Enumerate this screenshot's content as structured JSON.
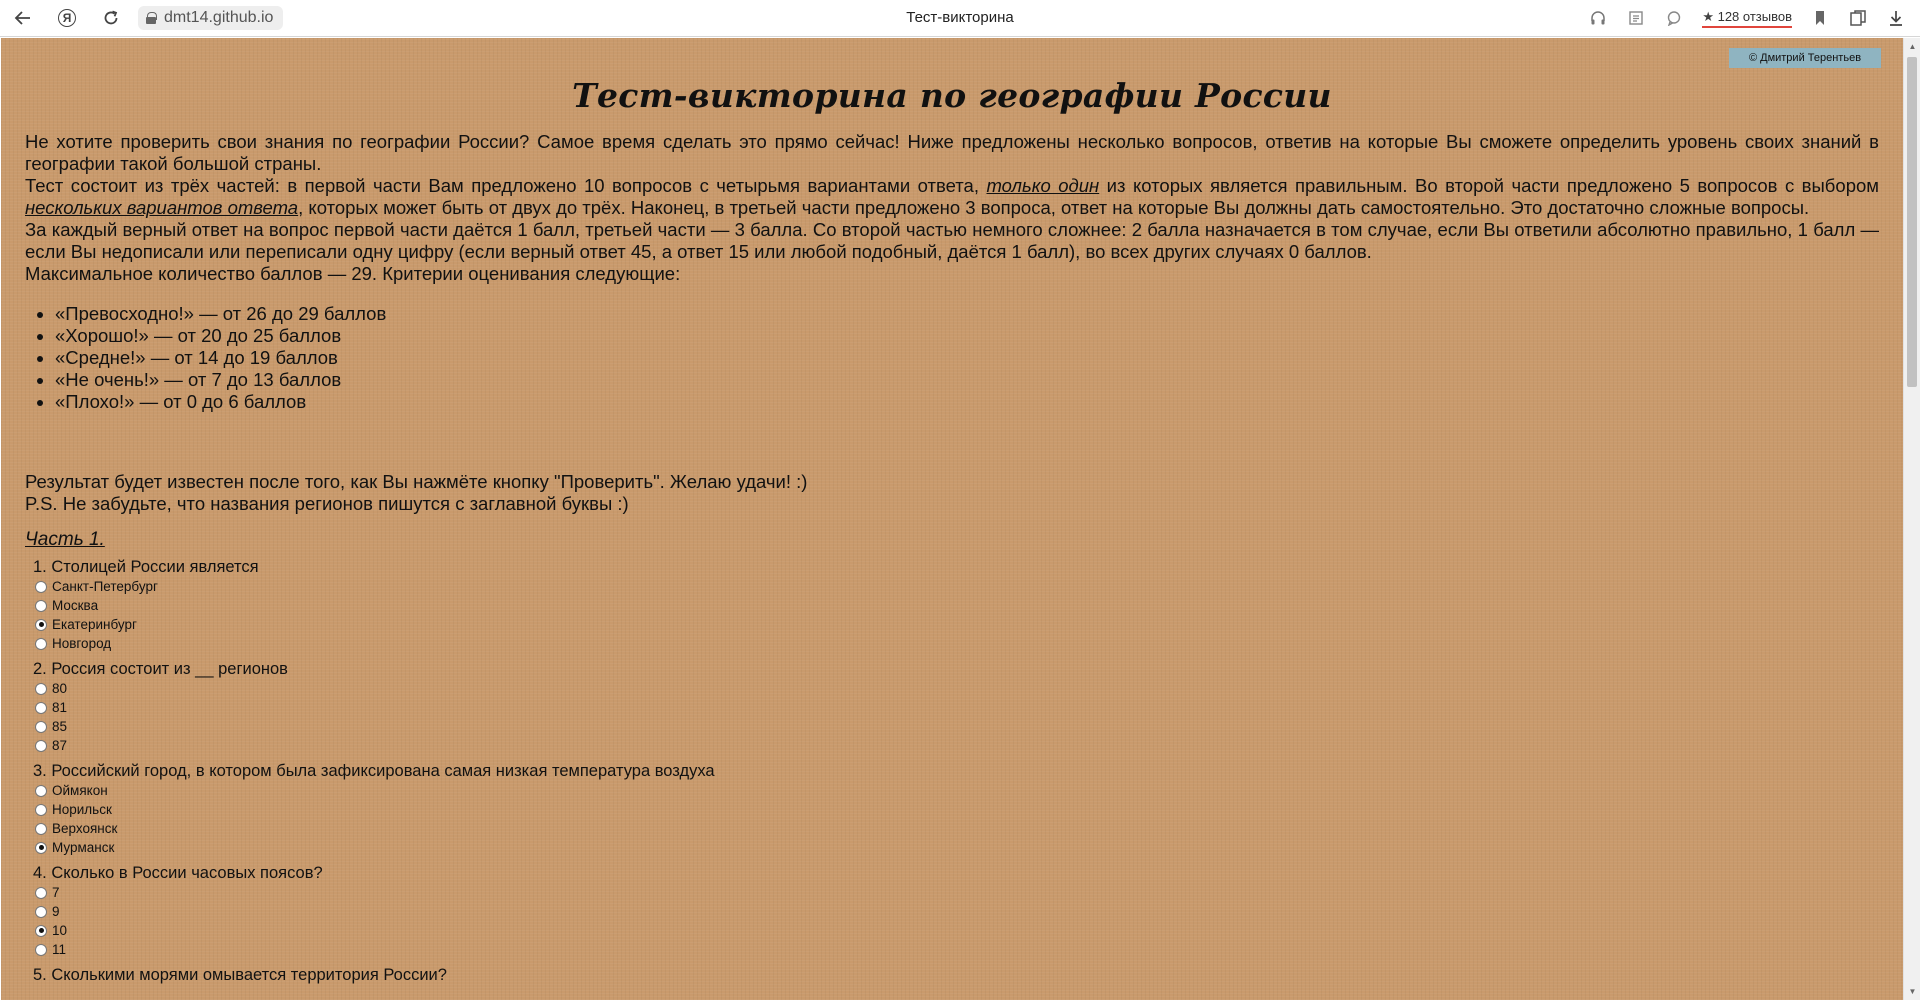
{
  "browser": {
    "url": "dmt14.github.io",
    "tab_title": "Тест-викторина",
    "reviews": "128 отзывов"
  },
  "page": {
    "author": "© Дмитрий Терентьев",
    "title": "Тест-викторина по географии России",
    "intro": {
      "p1": "Не хотите проверить свои знания по географии России? Самое время сделать это прямо сейчас! Ниже предложены несколько вопросов, ответив на которые Вы сможете определить уровень своих знаний в географии такой большой страны.",
      "p2_a": "Тест состоит из трёх частей: в первой части Вам предложено 10 вопросов с четырьмя вариантами ответа, ",
      "p2_em1": "только один",
      "p2_b": " из которых является правильным. Во второй части предложено 5 вопросов с выбором ",
      "p2_em2": "нескольких вариантов ответа",
      "p2_c": ", которых может быть от двух до трёх. Наконец, в третьей части предложено 3 вопроса, ответ на которые Вы должны дать самостоятельно. Это достаточно сложные вопросы.",
      "p3": "За каждый верный ответ на вопрос первой части даётся 1 балл, третьей части — 3 балла. Со второй частью немного сложнее: 2 балла назначается в том случае, если Вы ответили абсолютно правильно, 1 балл — если Вы недописали или переписали одну цифру (если верный ответ 45, а ответ 15 или любой подобный, даётся 1 балл), во всех других случаях 0 баллов.",
      "p4": "Максимальное количество баллов — 29. Критерии оценивания следующие:"
    },
    "criteria": [
      "«Превосходно!» — от 26 до 29 баллов",
      "«Хорошо!» — от 20 до 25 баллов",
      "«Средне!» — от 14 до 19 баллов",
      "«Не очень!» — от 7 до 13 баллов",
      "«Плохо!» — от 0 до 6 баллов"
    ],
    "result_1": "Результат будет известен после того, как Вы нажмёте кнопку \"Проверить\". Желаю удачи! :)",
    "result_2": "P.S. Не забудьте, что названия регионов пишутся с заглавной буквы :)",
    "part1_title": "Часть 1.",
    "questions": [
      {
        "text": "1. Столицей России является",
        "options": [
          "Санкт-Петербург",
          "Москва",
          "Екатеринбург",
          "Новгород"
        ],
        "selected": 2
      },
      {
        "text": "2. Россия состоит из __ регионов",
        "options": [
          "80",
          "81",
          "85",
          "87"
        ],
        "selected": -1
      },
      {
        "text": "3. Российский город, в котором была зафиксирована самая низкая температура воздуха",
        "options": [
          "Оймякон",
          "Норильск",
          "Верхоянск",
          "Мурманск"
        ],
        "selected": 3
      },
      {
        "text": "4. Сколько в России часовых поясов?",
        "options": [
          "7",
          "9",
          "10",
          "11"
        ],
        "selected": 2
      },
      {
        "text": "5. Сколькими морями омывается территория России?",
        "options": [],
        "selected": -1
      }
    ]
  }
}
